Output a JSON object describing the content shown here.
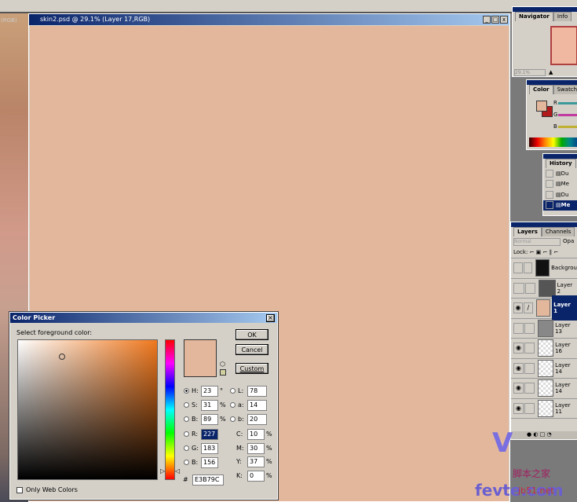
{
  "left_strip": {
    "title_fragment": "(RGB)"
  },
  "document": {
    "title": "skin2.psd @ 29.1% (Layer 17,RGB)",
    "canvas_color": "#E3B79C"
  },
  "navigator": {
    "tabs": [
      "Navigator",
      "Info"
    ],
    "zoom": "29.1%"
  },
  "color_panel": {
    "tabs": [
      "Color",
      "Swatch"
    ],
    "channels": [
      "R",
      "G",
      "B"
    ],
    "foreground": "#E3B79C",
    "background": "#B01A1A"
  },
  "history": {
    "tabs": [
      "History"
    ],
    "items": [
      "Du",
      "Me",
      "Du",
      "Me"
    ]
  },
  "layers": {
    "tabs": [
      "Layers",
      "Channels"
    ],
    "blend_mode": "Normal",
    "opacity_label": "Opa",
    "lock_label": "Lock:",
    "items": [
      {
        "name": "Backgrou",
        "visible": false,
        "active": false
      },
      {
        "name": "Layer 2",
        "visible": false,
        "active": false
      },
      {
        "name": "Layer 1",
        "visible": true,
        "active": true
      },
      {
        "name": "Layer 13",
        "visible": false,
        "active": false
      },
      {
        "name": "Layer 16",
        "visible": true,
        "active": false
      },
      {
        "name": "Layer 14",
        "visible": true,
        "active": false
      },
      {
        "name": "Layer 14",
        "visible": true,
        "active": false
      },
      {
        "name": "Layer 11",
        "visible": true,
        "active": false
      }
    ]
  },
  "color_picker": {
    "title": "Color Picker",
    "prompt": "Select foreground color:",
    "ok": "OK",
    "cancel": "Cancel",
    "custom": "Custom",
    "only_web": "Only Web Colors",
    "hsb": [
      {
        "label": "H:",
        "value": "23",
        "unit": "°"
      },
      {
        "label": "S:",
        "value": "31",
        "unit": "%"
      },
      {
        "label": "B:",
        "value": "89",
        "unit": "%"
      }
    ],
    "lab": [
      {
        "label": "L:",
        "value": "78"
      },
      {
        "label": "a:",
        "value": "14"
      },
      {
        "label": "b:",
        "value": "20"
      }
    ],
    "rgb": [
      {
        "label": "R:",
        "value": "227"
      },
      {
        "label": "G:",
        "value": "183"
      },
      {
        "label": "B:",
        "value": "156"
      }
    ],
    "cmyk": [
      {
        "label": "C:",
        "value": "10",
        "unit": "%"
      },
      {
        "label": "M:",
        "value": "30",
        "unit": "%"
      },
      {
        "label": "Y:",
        "value": "37",
        "unit": "%"
      },
      {
        "label": "K:",
        "value": "0",
        "unit": "%"
      }
    ],
    "hex_label": "#",
    "hex": "E3B79C",
    "selected_mode": "H"
  },
  "watermark": {
    "text": "fevte.com",
    "sub": "脚本之家",
    "sub2": "jb51.net"
  }
}
